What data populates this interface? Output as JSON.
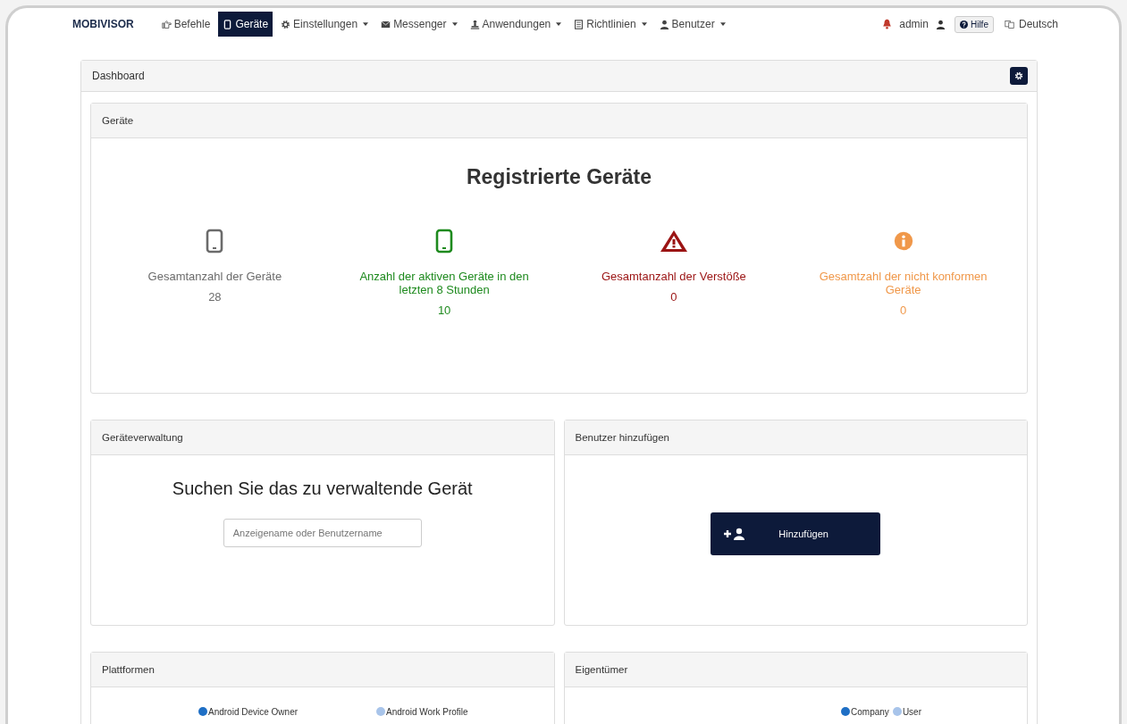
{
  "brand": "MOBIVISOR",
  "nav": [
    {
      "label": "Befehle",
      "kind": "hand",
      "dropdown": false,
      "selected": false
    },
    {
      "label": "Geräte",
      "kind": "phone",
      "dropdown": false,
      "selected": true
    },
    {
      "label": "Einstellungen",
      "kind": "gear",
      "dropdown": true,
      "selected": false
    },
    {
      "label": "Messenger",
      "kind": "mail",
      "dropdown": true,
      "selected": false
    },
    {
      "label": "Anwendungen",
      "kind": "app",
      "dropdown": true,
      "selected": false
    },
    {
      "label": "Richtlinien",
      "kind": "doc",
      "dropdown": true,
      "selected": false
    },
    {
      "label": "Benutzer",
      "kind": "user",
      "dropdown": true,
      "selected": false
    }
  ],
  "user": "admin",
  "help": "Hilfe",
  "language": "Deutsch",
  "dashboard": {
    "title": "Dashboard",
    "devices": {
      "title": "Geräte",
      "heading": "Registrierte Geräte",
      "stats": [
        {
          "kind": "device",
          "color": "#6b6b6b",
          "label": "Gesamtanzahl der Geräte",
          "value": "28"
        },
        {
          "kind": "device",
          "color": "#1e8a1e",
          "label": "Anzahl der aktiven Geräte in den letzten 8 Stunden",
          "value": "10"
        },
        {
          "kind": "warning",
          "color": "#9b1414",
          "label": "Gesamtanzahl der Verstöße",
          "value": "0"
        },
        {
          "kind": "info",
          "color": "#f0984a",
          "label": "Gesamtzahl der nicht konformen Geräte",
          "value": "0"
        }
      ]
    },
    "management": {
      "title": "Geräteverwaltung",
      "heading": "Suchen Sie das zu verwaltende Gerät",
      "placeholder": "Anzeigename oder Benutzername"
    },
    "add_user": {
      "title": "Benutzer hinzufügen",
      "button": "Hinzufügen"
    },
    "platforms": {
      "title": "Plattformen",
      "legend": [
        {
          "label": "Android Device Owner",
          "color": "#1f6fc5"
        },
        {
          "label": "Android Work Profile",
          "color": "#a8c4ea"
        }
      ]
    },
    "owners": {
      "title": "Eigentümer",
      "legend": [
        {
          "label": "Company",
          "color": "#1f6fc5"
        },
        {
          "label": "User",
          "color": "#a8c4ea"
        }
      ]
    }
  }
}
